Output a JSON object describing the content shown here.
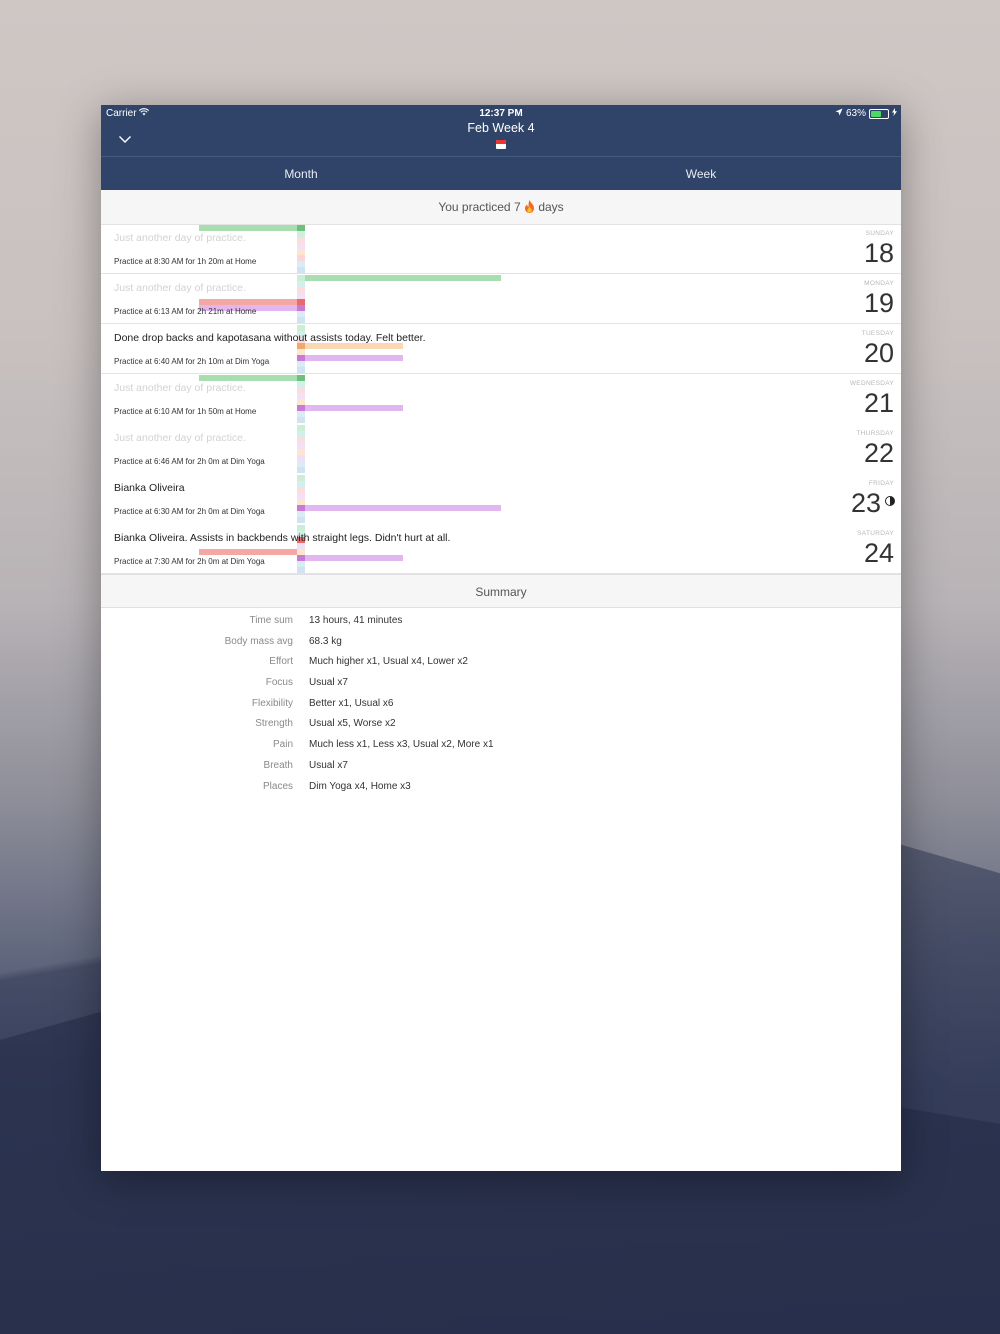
{
  "status": {
    "carrier": "Carrier",
    "time": "12:37 PM",
    "battery": "63%"
  },
  "header": {
    "title": "Feb Week 4"
  },
  "tabs": [
    {
      "label": "Month"
    },
    {
      "label": "Week"
    }
  ],
  "practiced": {
    "prefix": "You practiced 7",
    "suffix": "days"
  },
  "days": [
    {
      "weekday": "SUNDAY",
      "date": "18",
      "note": "Just another day of practice.",
      "note_faint": true,
      "practice": "Practice at 8:30 AM for 1h 20m at Home"
    },
    {
      "weekday": "MONDAY",
      "date": "19",
      "note": "Just another day of practice.",
      "note_faint": true,
      "practice": "Practice at 6:13 AM for 2h 21m at Home"
    },
    {
      "weekday": "TUESDAY",
      "date": "20",
      "note": "Done drop backs and kapotasana without assists today. Felt better.",
      "note_faint": false,
      "practice": "Practice at 6:40 AM for 2h 10m at Dim Yoga"
    },
    {
      "weekday": "WEDNESDAY",
      "date": "21",
      "note": "Just another day of practice.",
      "note_faint": true,
      "practice": "Practice at 6:10 AM for 1h 50m at Home"
    },
    {
      "weekday": "THURSDAY",
      "date": "22",
      "note": "Just another day of practice.",
      "note_faint": true,
      "practice": "Practice at 6:46 AM for 2h 0m at Dim Yoga"
    },
    {
      "weekday": "FRIDAY",
      "date": "23",
      "note": "Bianka Oliveira",
      "note_faint": false,
      "practice": "Practice at 6:30 AM for 2h 0m at Dim Yoga"
    },
    {
      "weekday": "SATURDAY",
      "date": "24",
      "note": "Bianka Oliveira. Assists in backbends with straight legs. Didn't hurt at all.",
      "note_faint": false,
      "practice": "Practice at 7:30 AM for 2h 0m at Dim Yoga"
    }
  ],
  "summary": {
    "title": "Summary",
    "rows": [
      {
        "label": "Time sum",
        "value": "13 hours, 41 minutes"
      },
      {
        "label": "Body mass avg",
        "value": "68.3 kg"
      },
      {
        "label": "Effort",
        "value": "Much higher x1, Usual x4, Lower x2"
      },
      {
        "label": "Focus",
        "value": "Usual x7"
      },
      {
        "label": "Flexibility",
        "value": "Better x1, Usual x6"
      },
      {
        "label": "Strength",
        "value": "Usual x5, Worse x2"
      },
      {
        "label": "Pain",
        "value": "Much less x1, Less x3, Usual x2, More x1"
      },
      {
        "label": "Breath",
        "value": "Usual x7"
      },
      {
        "label": "Places",
        "value": "Dim Yoga x4, Home x3"
      }
    ]
  },
  "colors": {
    "header_bg": "#2f4468",
    "green": "#a8ddb0",
    "red": "#f4a7a3",
    "purple": "#e2b7ef",
    "orange": "#fbd8b4"
  }
}
